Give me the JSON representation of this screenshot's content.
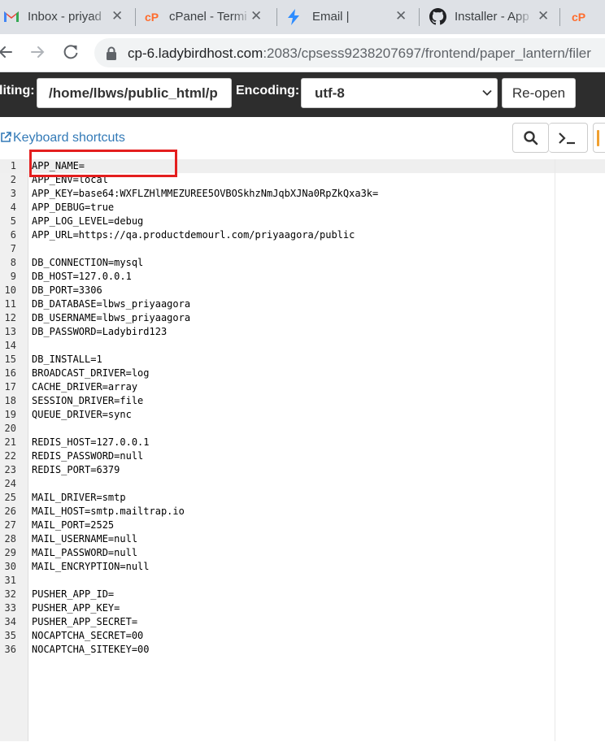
{
  "tabs": [
    {
      "title": "Inbox - priyad",
      "icon": "gmail-icon"
    },
    {
      "title": "cPanel - Termi",
      "icon": "cpanel-icon"
    },
    {
      "title": "Email |",
      "icon": "lightning-icon"
    },
    {
      "title": "Installer - App",
      "icon": "github-icon"
    },
    {
      "title": "cP",
      "icon": "cpanel-icon"
    }
  ],
  "address_bar": {
    "host": "cp-6.ladybirdhost.com",
    "path": ":2083/cpsess9238207697/frontend/paper_lantern/filer"
  },
  "editor_bar": {
    "editing_label": "liting:",
    "path_value": "/home/lbws/public_html/p",
    "encoding_label": "Encoding:",
    "encoding_value": "utf-8",
    "reopen_label": "Re-open"
  },
  "shortcuts": {
    "keyboard_label": "Keyboard shortcuts"
  },
  "code_lines": [
    "APP_NAME=",
    "APP_ENV=local",
    "APP_KEY=base64:WXFLZHlMMEZUREE5OVBOSkhzNmJqbXJNa0RpZkQxa3k=",
    "APP_DEBUG=true",
    "APP_LOG_LEVEL=debug",
    "APP_URL=https://qa.productdemourl.com/priyaagora/public",
    "",
    "DB_CONNECTION=mysql",
    "DB_HOST=127.0.0.1",
    "DB_PORT=3306",
    "DB_DATABASE=lbws_priyaagora",
    "DB_USERNAME=lbws_priyaagora",
    "DB_PASSWORD=Ladybird123",
    "",
    "DB_INSTALL=1",
    "BROADCAST_DRIVER=log",
    "CACHE_DRIVER=array",
    "SESSION_DRIVER=file",
    "QUEUE_DRIVER=sync",
    "",
    "REDIS_HOST=127.0.0.1",
    "REDIS_PASSWORD=null",
    "REDIS_PORT=6379",
    "",
    "MAIL_DRIVER=smtp",
    "MAIL_HOST=smtp.mailtrap.io",
    "MAIL_PORT=2525",
    "MAIL_USERNAME=null",
    "MAIL_PASSWORD=null",
    "MAIL_ENCRYPTION=null",
    "",
    "PUSHER_APP_ID=",
    "PUSHER_APP_KEY=",
    "PUSHER_APP_SECRET=",
    "NOCAPTCHA_SECRET=00",
    "NOCAPTCHA_SITEKEY=00"
  ],
  "colors": {
    "highlight": "#e41e1e",
    "link": "#337ab7",
    "editor_bar": "#2d2d2d"
  }
}
